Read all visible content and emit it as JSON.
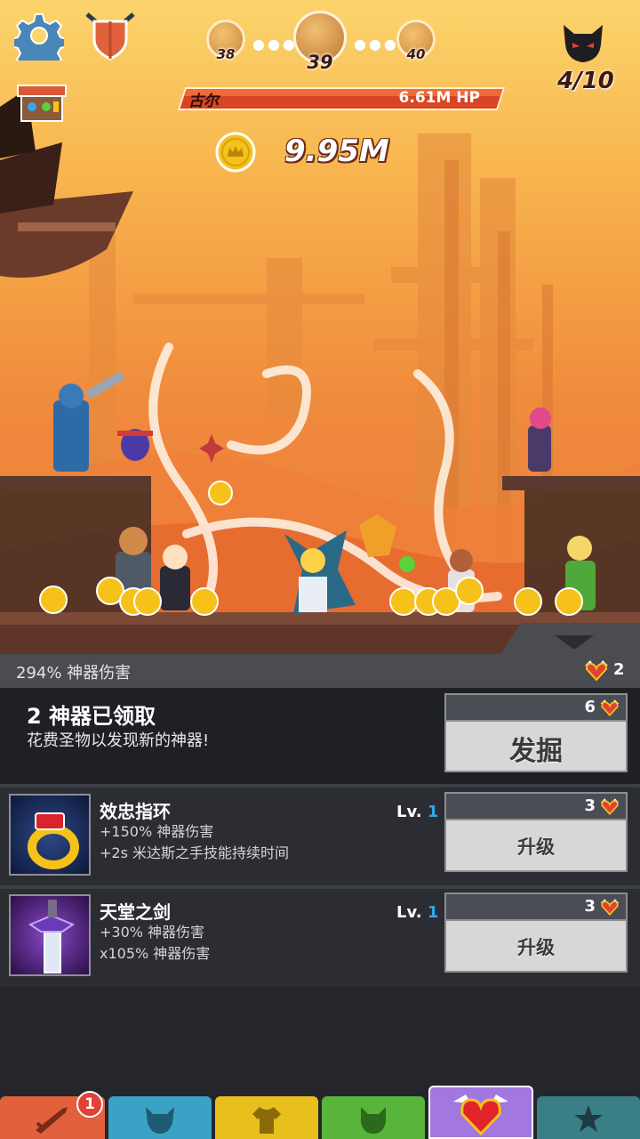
{
  "hud": {
    "boss_counter": "4/10",
    "stage": {
      "prev": "38",
      "current": "39",
      "next": "40"
    },
    "boss_name": "古尔",
    "boss_hp": "6.61M HP",
    "gold": "9.95M"
  },
  "panel": {
    "artifact_damage": "294% 神器伤害",
    "relic_count": "2",
    "discover": {
      "title": "2 神器已领取",
      "subtitle": "花费圣物以发现新的神器!",
      "cost": "6",
      "button": "发掘"
    },
    "artifacts": [
      {
        "name": "效忠指环",
        "lines": [
          "+150% 神器伤害",
          "+2s 米达斯之手技能持续时间"
        ],
        "level_label": "Lv.",
        "level": "1",
        "cost": "3",
        "button": "升级"
      },
      {
        "name": "天堂之剑",
        "lines": [
          "+30% 神器伤害",
          "x105% 神器伤害"
        ],
        "level_label": "Lv.",
        "level": "1",
        "cost": "3",
        "button": "升级"
      }
    ]
  },
  "nav": {
    "tabs": [
      "hero",
      "heroes",
      "equipment",
      "pets",
      "artifacts",
      "shop"
    ],
    "active": "artifacts",
    "hero_badge": "1"
  },
  "colors": {
    "sky_top": "#fbd46b",
    "sky_bottom": "#e8793a",
    "hp_bar": "#d74524",
    "level_number": "#36a4ec",
    "button_face": "#d7d7d7",
    "nav_hero": "#e0613c",
    "nav_heroes": "#3aa2c4",
    "nav_equipment": "#e8c01e",
    "nav_pets": "#58b43a",
    "nav_artifacts": "#a277e0",
    "nav_shop": "#3a7e86"
  }
}
